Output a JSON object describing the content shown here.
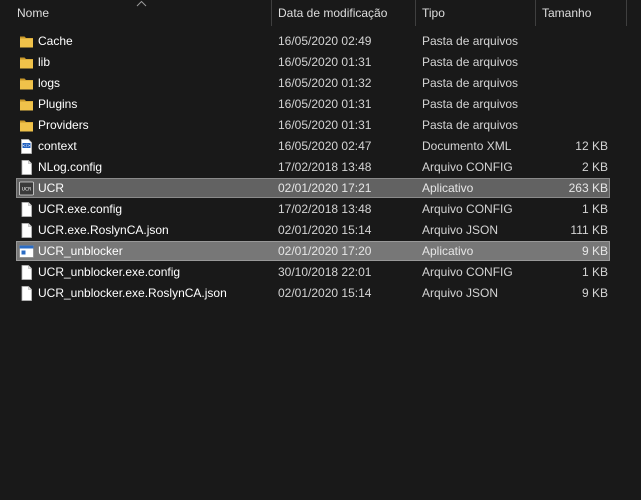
{
  "columns": {
    "name": "Nome",
    "date": "Data de modificação",
    "type": "Tipo",
    "size": "Tamanho"
  },
  "sort": {
    "column": "name",
    "direction": "ascending",
    "icon": "sort-up-chevron-icon"
  },
  "files": [
    {
      "name": "Cache",
      "date": "16/05/2020 02:49",
      "type": "Pasta de arquivos",
      "size": "",
      "icon": "folder-icon",
      "state": ""
    },
    {
      "name": "lib",
      "date": "16/05/2020 01:31",
      "type": "Pasta de arquivos",
      "size": "",
      "icon": "folder-icon",
      "state": ""
    },
    {
      "name": "logs",
      "date": "16/05/2020 01:32",
      "type": "Pasta de arquivos",
      "size": "",
      "icon": "folder-icon",
      "state": ""
    },
    {
      "name": "Plugins",
      "date": "16/05/2020 01:31",
      "type": "Pasta de arquivos",
      "size": "",
      "icon": "folder-icon",
      "state": ""
    },
    {
      "name": "Providers",
      "date": "16/05/2020 01:31",
      "type": "Pasta de arquivos",
      "size": "",
      "icon": "folder-icon",
      "state": ""
    },
    {
      "name": "context",
      "date": "16/05/2020 02:47",
      "type": "Documento XML",
      "size": "12 KB",
      "icon": "xml-file-icon",
      "state": ""
    },
    {
      "name": "NLog.config",
      "date": "17/02/2018 13:48",
      "type": "Arquivo CONFIG",
      "size": "2 KB",
      "icon": "file-icon",
      "state": ""
    },
    {
      "name": "UCR",
      "date": "02/01/2020 17:21",
      "type": "Aplicativo",
      "size": "263 KB",
      "icon": "ucr-app-icon",
      "state": "selected-dark"
    },
    {
      "name": "UCR.exe.config",
      "date": "17/02/2018 13:48",
      "type": "Arquivo CONFIG",
      "size": "1 KB",
      "icon": "file-icon",
      "state": ""
    },
    {
      "name": "UCR.exe.RoslynCA.json",
      "date": "02/01/2020 15:14",
      "type": "Arquivo JSON",
      "size": "111 KB",
      "icon": "file-icon",
      "state": ""
    },
    {
      "name": "UCR_unblocker",
      "date": "02/01/2020 17:20",
      "type": "Aplicativo",
      "size": "9 KB",
      "icon": "window-app-icon",
      "state": "selected"
    },
    {
      "name": "UCR_unblocker.exe.config",
      "date": "30/10/2018 22:01",
      "type": "Arquivo CONFIG",
      "size": "1 KB",
      "icon": "file-icon",
      "state": ""
    },
    {
      "name": "UCR_unblocker.exe.RoslynCA.json",
      "date": "02/01/2020 15:14",
      "type": "Arquivo JSON",
      "size": "9 KB",
      "icon": "file-icon",
      "state": ""
    }
  ],
  "colors": {
    "background": "#191919",
    "folder": "#e8b93a",
    "selection": "#777777"
  }
}
